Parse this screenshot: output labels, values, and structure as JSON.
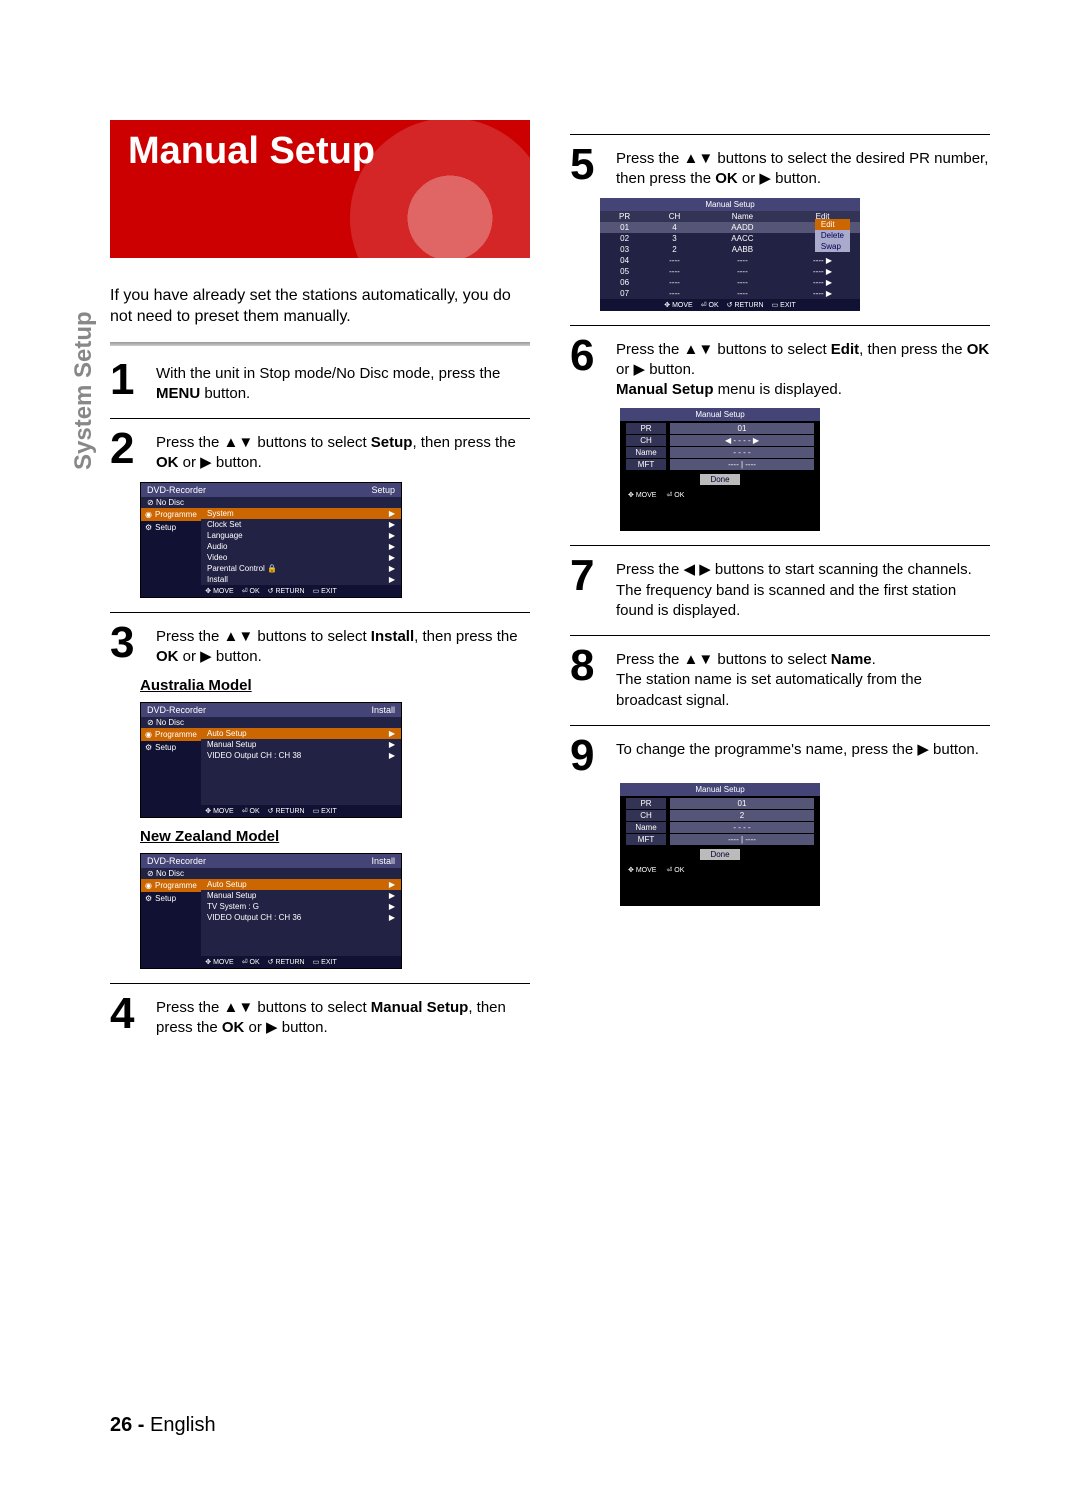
{
  "page": {
    "number": "26 -",
    "lang": "English",
    "side_tab": "System Setup"
  },
  "title": "Manual Setup",
  "intro": "If you have already set the stations automatically, you do not need to preset them manually.",
  "steps": {
    "s1": {
      "n": "1",
      "t1": "With the unit in Stop mode/No Disc mode, press the ",
      "b1": "MENU",
      "t2": " button."
    },
    "s2": {
      "n": "2",
      "t1": "Press the ▲▼ buttons to select ",
      "b1": "Setup",
      "t2": ", then press the ",
      "b2": "OK",
      "t3": " or ▶ button."
    },
    "s3": {
      "n": "3",
      "t1": "Press the ▲▼ buttons to select ",
      "b1": "Install",
      "t2": ", then press the ",
      "b2": "OK",
      "t3": " or ▶ button."
    },
    "s4": {
      "n": "4",
      "t1": "Press the ▲▼ buttons to select ",
      "b1": "Manual Setup",
      "t2": ", then press the ",
      "b2": "OK",
      "t3": " or ▶ button."
    },
    "s5": {
      "n": "5",
      "t1": "Press the ▲▼ buttons to select the desired PR number, then press the ",
      "b1": "OK",
      "t2": " or ▶ button."
    },
    "s6": {
      "n": "6",
      "t1": "Press the ▲▼ buttons to select ",
      "b1": "Edit",
      "t2": ", then press the ",
      "b2": "OK",
      "t3": " or ▶ button.",
      "extra": "Manual Setup",
      "extra2": " menu is displayed."
    },
    "s7": {
      "n": "7",
      "t1": "Press the ◀ ▶ buttons to start scanning the channels.",
      "t2": "The frequency band is scanned and the first station found is displayed."
    },
    "s8": {
      "n": "8",
      "t1": "Press the ▲▼ buttons to select ",
      "b1": "Name",
      "t2": ".",
      "t3": "The station name is set automatically from the broadcast signal."
    },
    "s9": {
      "n": "9",
      "t1": "To change the programme's name, press the ▶ button."
    }
  },
  "subheads": {
    "aus": "Australia Model",
    "nz": "New Zealand Model"
  },
  "osd_common": {
    "title": "DVD-Recorder",
    "nodisc": "No Disc",
    "side": {
      "prog": "Programme",
      "setup": "Setup"
    },
    "foot": {
      "move": "MOVE",
      "ok": "OK",
      "return": "RETURN",
      "exit": "EXIT"
    }
  },
  "osd_setup": {
    "corner": "Setup",
    "rows": [
      "System",
      "Clock Set",
      "Language",
      "Audio",
      "Video",
      "Parental Control",
      "Install"
    ]
  },
  "osd_install_aus": {
    "corner": "Install",
    "rows": [
      "Auto Setup",
      "Manual Setup",
      "VIDEO Output CH  : CH 38"
    ]
  },
  "osd_install_nz": {
    "corner": "Install",
    "rows": [
      "Auto Setup",
      "Manual Setup",
      "TV System  : G",
      "VIDEO Output CH  : CH 36"
    ]
  },
  "osd_table": {
    "title": "Manual Setup",
    "headers": [
      "PR",
      "CH",
      "Name",
      "Edit"
    ],
    "rows": [
      [
        "01",
        "4",
        "AADD",
        "----"
      ],
      [
        "02",
        "3",
        "AACC",
        "----"
      ],
      [
        "03",
        "2",
        "AABB",
        "----"
      ],
      [
        "04",
        "----",
        "----",
        "----"
      ],
      [
        "05",
        "----",
        "----",
        "----"
      ],
      [
        "06",
        "----",
        "----",
        "----"
      ],
      [
        "07",
        "----",
        "----",
        "----"
      ]
    ],
    "popup": [
      "Edit",
      "Delete",
      "Swap"
    ]
  },
  "osd_form": {
    "title": "Manual Setup",
    "fields": [
      {
        "lbl": "PR",
        "val": "01"
      },
      {
        "lbl": "CH",
        "val": "◀ - - - - ▶"
      },
      {
        "lbl": "Name",
        "val": "- - - -"
      },
      {
        "lbl": "MFT",
        "val": "---- | ----"
      }
    ],
    "done": "Done"
  },
  "osd_form2": {
    "title": "Manual Setup",
    "fields": [
      {
        "lbl": "PR",
        "val": "01"
      },
      {
        "lbl": "CH",
        "val": "2"
      },
      {
        "lbl": "Name",
        "val": "- - - -"
      },
      {
        "lbl": "MFT",
        "val": "---- | ----"
      }
    ],
    "done": "Done"
  }
}
